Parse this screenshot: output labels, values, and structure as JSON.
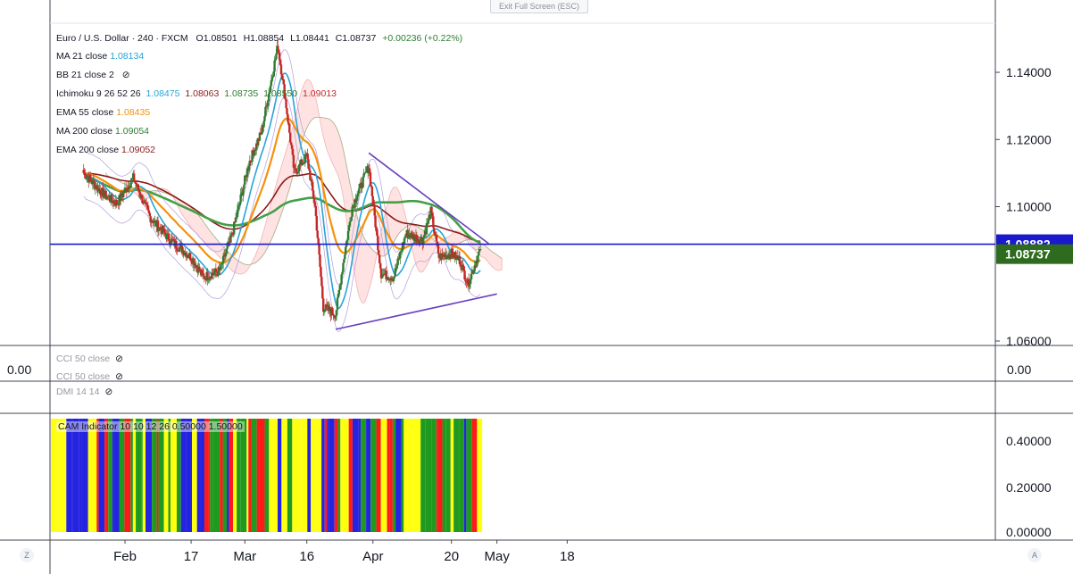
{
  "exit_label": "Exit Full Screen (ESC)",
  "header": {
    "symbol": "Euro / U.S. Dollar · 240 · FXCM",
    "o": "O1.08501",
    "h": "H1.08854",
    "l": "L1.08441",
    "c": "C1.08737",
    "change": "+0.00236 (+0.22%)"
  },
  "legend": {
    "ma21": {
      "label": "MA 21 close",
      "value": "1.08134"
    },
    "bb": {
      "label": "BB 21 close 2"
    },
    "ichimoku": {
      "label": "Ichimoku 9 26 52 26",
      "values": [
        "1.08475",
        "1.08063",
        "1.08735",
        "1.08550",
        "1.09013"
      ]
    },
    "ema55": {
      "label": "EMA 55 close",
      "value": "1.08435"
    },
    "ma200": {
      "label": "MA 200 close",
      "value": "1.09054"
    },
    "ema200": {
      "label": "EMA 200 close",
      "value": "1.09052"
    }
  },
  "panes": {
    "cci": {
      "label1": "CCI 50 close",
      "label2": "CCI 50 close",
      "left_value": "0.00",
      "right_value": "0.00"
    },
    "dmi": {
      "label": "DMI 14 14"
    },
    "cam": {
      "label": "CAM Indicator 10 10 12 26 0.50000 1.50000",
      "ticks": [
        "0.40000",
        "0.20000",
        "0.00000"
      ]
    }
  },
  "corners": {
    "left": "Z",
    "right": "A"
  },
  "colors": {
    "up": "#2e7d32",
    "down": "#c62828",
    "ma21": "#29a3d9",
    "ema55": "#f5920b",
    "ma200": "#43a047",
    "ema200": "#8b1a1a",
    "hline": "#1a1acc",
    "trend": "#6a3fc0",
    "price_label_bg": "#1a1acc",
    "last_label_bg": "#2e6b1f"
  },
  "chart_data": {
    "type": "candlestick",
    "symbol": "EURUSD",
    "timeframe": "240",
    "y_ticks": [
      "1.14000",
      "1.12000",
      "1.10000",
      "1.06000"
    ],
    "ylim": [
      1.0595,
      1.1545
    ],
    "x_ticks": [
      "Feb",
      "17",
      "Mar",
      "16",
      "Apr",
      "20",
      "May",
      "18"
    ],
    "horizontal_line": 1.08882,
    "last_price": 1.08737,
    "price_labels": [
      "1.08882",
      "1.08737"
    ],
    "price_path": [
      [
        "Jan 22",
        1.11
      ],
      [
        "Jan 27",
        1.1035
      ],
      [
        "Jan 30",
        1.101
      ],
      [
        "Feb 3",
        1.1085
      ],
      [
        "Feb 7",
        1.097
      ],
      [
        "Feb 12",
        1.09
      ],
      [
        "Feb 17",
        1.085
      ],
      [
        "Feb 20",
        1.079
      ],
      [
        "Feb 24",
        1.081
      ],
      [
        "Feb 27",
        1.092
      ],
      [
        "Mar 2",
        1.113
      ],
      [
        "Mar 5",
        1.122
      ],
      [
        "Mar 9",
        1.148
      ],
      [
        "Mar 11",
        1.13
      ],
      [
        "Mar 13",
        1.11
      ],
      [
        "Mar 16",
        1.115
      ],
      [
        "Mar 18",
        1.1
      ],
      [
        "Mar 20",
        1.07
      ],
      [
        "Mar 23",
        1.068
      ],
      [
        "Mar 25",
        1.085
      ],
      [
        "Mar 27",
        1.1
      ],
      [
        "Mar 31",
        1.112
      ],
      [
        "Apr 3",
        1.08
      ],
      [
        "Apr 6",
        1.079
      ],
      [
        "Apr 9",
        1.092
      ],
      [
        "Apr 13",
        1.09
      ],
      [
        "Apr 15",
        1.0985
      ],
      [
        "Apr 17",
        1.085
      ],
      [
        "Apr 20",
        1.086
      ],
      [
        "Apr 22",
        1.084
      ],
      [
        "Apr 24",
        1.077
      ],
      [
        "Apr 27",
        1.0874
      ]
    ],
    "series": [
      {
        "name": "MA 21 close",
        "last": 1.08134
      },
      {
        "name": "EMA 55 close",
        "last": 1.08435
      },
      {
        "name": "MA 200 close",
        "last": 1.09054
      },
      {
        "name": "EMA 200 close",
        "last": 1.09052
      }
    ],
    "cam_colors": [
      "red",
      "green",
      "blue",
      "yellow"
    ]
  }
}
